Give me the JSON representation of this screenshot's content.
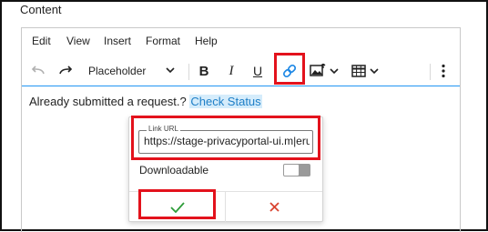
{
  "section": {
    "label": "Content"
  },
  "menubar": {
    "items": [
      "Edit",
      "View",
      "Insert",
      "Format",
      "Help"
    ]
  },
  "toolbar": {
    "style_select": "Placeholder",
    "buttons": {
      "undo": "undo-icon",
      "redo": "redo-icon",
      "bold": "B",
      "italic": "I",
      "underline": "U",
      "link": "link-icon",
      "image": "image-icon",
      "table": "table-icon",
      "more": "more-vertical-icon"
    }
  },
  "content": {
    "text": "Already submitted a request.?",
    "link_text": "Check Status"
  },
  "link_popup": {
    "url_label": "Link URL",
    "url_value": "https://stage-privacyportal-ui.m|eru",
    "downloadable_label": "Downloadable",
    "downloadable_on": false
  },
  "colors": {
    "highlight": "#e3121c",
    "accent": "#2196f3",
    "confirm": "#2e9d3a",
    "cancel": "#d9432f"
  }
}
